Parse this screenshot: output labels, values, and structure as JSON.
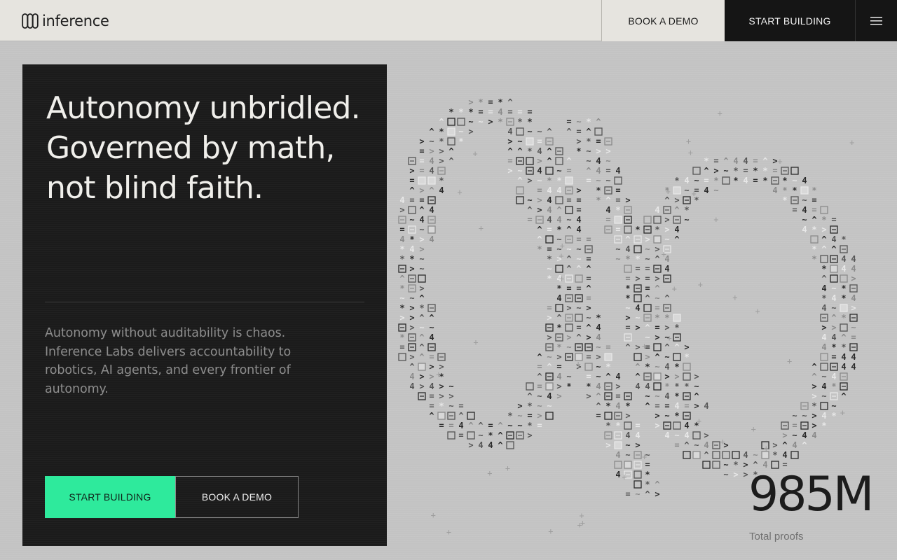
{
  "header": {
    "logo_text": "inference",
    "logo_icon": "infinity-loops-icon",
    "book_demo_label": "BOOK A DEMO",
    "start_building_label": "START BUILDING",
    "menu_icon": "hamburger-menu-icon"
  },
  "hero": {
    "title_lines": [
      "Autonomy unbridled.",
      "Governed by math,",
      "not blind faith."
    ],
    "description": "Autonomy without auditability is chaos. Inference Labs delivers accountability to robotics, AI agents, and every frontier of autonomy.",
    "primary_cta": "START BUILDING",
    "secondary_cta": "BOOK A DEMO"
  },
  "stats": {
    "value": "985M",
    "label": "Total proofs"
  },
  "visual": {
    "icon": "ascii-infinity-graphic",
    "glyphs": [
      "4",
      "~",
      "*",
      "⊟",
      "□",
      ">",
      "^",
      "="
    ]
  },
  "colors": {
    "accent": "#2eea9c",
    "dark": "#1b1b1b",
    "light_bar": "#e6e4df",
    "background": "#c3c3c3"
  }
}
